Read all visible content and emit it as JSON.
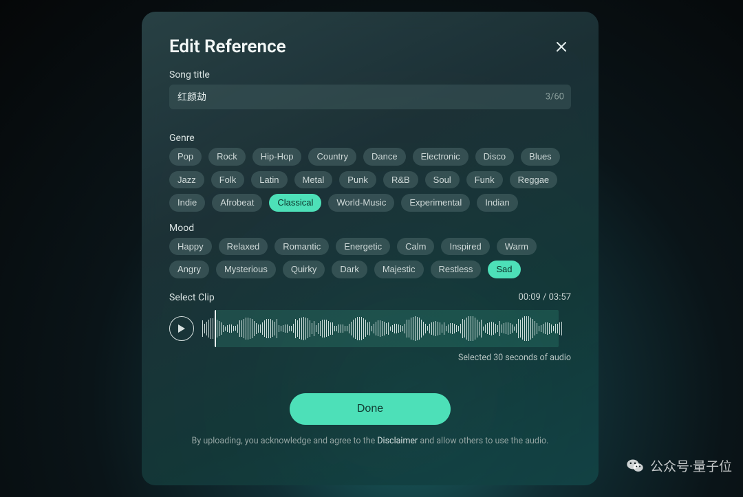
{
  "modal": {
    "title": "Edit Reference",
    "song_title_label": "Song title",
    "song_title_value": "红颜劫",
    "char_count": "3/60",
    "genre_label": "Genre",
    "genres": [
      {
        "label": "Pop",
        "selected": false
      },
      {
        "label": "Rock",
        "selected": false
      },
      {
        "label": "Hip-Hop",
        "selected": false
      },
      {
        "label": "Country",
        "selected": false
      },
      {
        "label": "Dance",
        "selected": false
      },
      {
        "label": "Electronic",
        "selected": false
      },
      {
        "label": "Disco",
        "selected": false
      },
      {
        "label": "Blues",
        "selected": false
      },
      {
        "label": "Jazz",
        "selected": false
      },
      {
        "label": "Folk",
        "selected": false
      },
      {
        "label": "Latin",
        "selected": false
      },
      {
        "label": "Metal",
        "selected": false
      },
      {
        "label": "Punk",
        "selected": false
      },
      {
        "label": "R&B",
        "selected": false
      },
      {
        "label": "Soul",
        "selected": false
      },
      {
        "label": "Funk",
        "selected": false
      },
      {
        "label": "Reggae",
        "selected": false
      },
      {
        "label": "Indie",
        "selected": false
      },
      {
        "label": "Afrobeat",
        "selected": false
      },
      {
        "label": "Classical",
        "selected": true
      },
      {
        "label": "World-Music",
        "selected": false
      },
      {
        "label": "Experimental",
        "selected": false
      },
      {
        "label": "Indian",
        "selected": false
      }
    ],
    "mood_label": "Mood",
    "moods": [
      {
        "label": "Happy",
        "selected": false
      },
      {
        "label": "Relaxed",
        "selected": false
      },
      {
        "label": "Romantic",
        "selected": false
      },
      {
        "label": "Energetic",
        "selected": false
      },
      {
        "label": "Calm",
        "selected": false
      },
      {
        "label": "Inspired",
        "selected": false
      },
      {
        "label": "Warm",
        "selected": false
      },
      {
        "label": "Angry",
        "selected": false
      },
      {
        "label": "Mysterious",
        "selected": false
      },
      {
        "label": "Quirky",
        "selected": false
      },
      {
        "label": "Dark",
        "selected": false
      },
      {
        "label": "Majestic",
        "selected": false
      },
      {
        "label": "Restless",
        "selected": false
      },
      {
        "label": "Sad",
        "selected": true
      }
    ],
    "select_clip_label": "Select Clip",
    "clip_time": "00:09 / 03:57",
    "clip_footer": "Selected 30 seconds of audio",
    "done_label": "Done",
    "disclaimer_prefix": "By uploading, you acknowledge and agree to the ",
    "disclaimer_link": "Disclaimer",
    "disclaimer_suffix": " and allow others to use the audio."
  },
  "watermark": "公众号·量子位"
}
